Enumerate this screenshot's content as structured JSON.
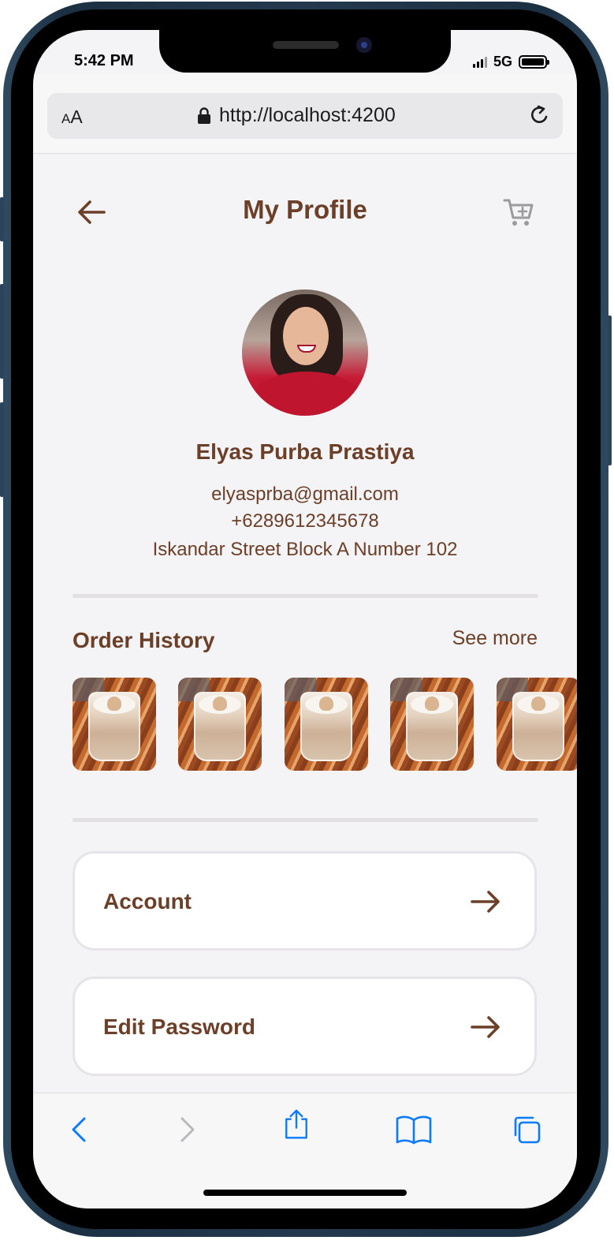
{
  "status_bar": {
    "time": "5:42 PM",
    "network": "5G"
  },
  "browser": {
    "text_size_small": "A",
    "text_size_large": "A",
    "url": "http://localhost:4200"
  },
  "header": {
    "title": "My Profile"
  },
  "profile": {
    "name": "Elyas Purba Prastiya",
    "email": "elyasprba@gmail.com",
    "phone": "+6289612345678",
    "address": "Iskandar Street Block A Number 102"
  },
  "order_history": {
    "title": "Order History",
    "see_more": "See more",
    "items": [
      "latte-art-coffee",
      "latte-art-coffee",
      "latte-art-coffee",
      "latte-art-coffee",
      "latte-art-coffee"
    ]
  },
  "menu": {
    "items": [
      {
        "label": "Account"
      },
      {
        "label": "Edit Password"
      }
    ]
  },
  "colors": {
    "brand_brown": "#6c3f28",
    "background": "#f4f3f6",
    "ios_blue": "#0a7aff"
  }
}
